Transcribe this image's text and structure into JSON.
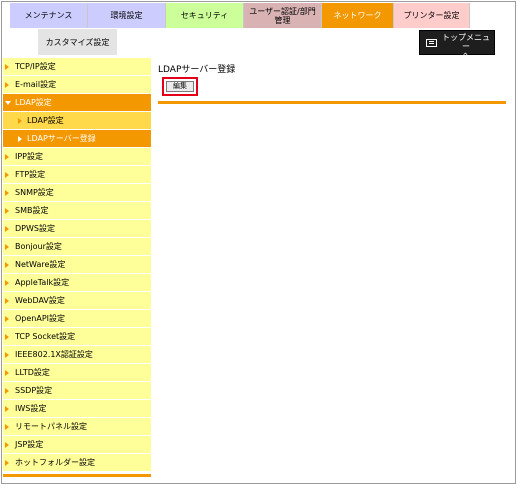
{
  "tabs": [
    {
      "label": "メンテナンス",
      "bg": "#ccccff",
      "fg": "#000000"
    },
    {
      "label": "環境設定",
      "bg": "#ccccff",
      "fg": "#000000"
    },
    {
      "label": "セキュリティ",
      "bg": "#ccff99",
      "fg": "#000000"
    },
    {
      "label": "ユーザー認証/部門\n管理",
      "bg": "#d9b3b3",
      "fg": "#000000"
    },
    {
      "label": "ネットワーク",
      "bg": "#f39800",
      "fg": "#ffffff"
    },
    {
      "label": "プリンター設定",
      "bg": "#ffcccc",
      "fg": "#000000"
    }
  ],
  "subtab": {
    "label": "カスタマイズ設定"
  },
  "topmenu": {
    "label": "トップメニュー\nへ",
    "icon": "top-menu-icon"
  },
  "sidebar": {
    "items": [
      {
        "label": "TCP/IP設定",
        "state": "normal"
      },
      {
        "label": "E-mail設定",
        "state": "normal"
      },
      {
        "label": "LDAP設定",
        "state": "open"
      },
      {
        "label": "LDAP設定",
        "state": "sub1"
      },
      {
        "label": "LDAPサーバー登録",
        "state": "sub2"
      },
      {
        "label": "IPP設定",
        "state": "normal"
      },
      {
        "label": "FTP設定",
        "state": "normal"
      },
      {
        "label": "SNMP設定",
        "state": "normal"
      },
      {
        "label": "SMB設定",
        "state": "normal"
      },
      {
        "label": "DPWS設定",
        "state": "normal"
      },
      {
        "label": "Bonjour設定",
        "state": "normal"
      },
      {
        "label": "NetWare設定",
        "state": "normal"
      },
      {
        "label": "AppleTalk設定",
        "state": "normal"
      },
      {
        "label": "WebDAV設定",
        "state": "normal"
      },
      {
        "label": "OpenAPI設定",
        "state": "normal"
      },
      {
        "label": "TCP Socket設定",
        "state": "normal"
      },
      {
        "label": "IEEE802.1X認証設定",
        "state": "normal"
      },
      {
        "label": "LLTD設定",
        "state": "normal"
      },
      {
        "label": "SSDP設定",
        "state": "normal"
      },
      {
        "label": "IWS設定",
        "state": "normal"
      },
      {
        "label": "リモートパネル設定",
        "state": "normal"
      },
      {
        "label": "JSP設定",
        "state": "normal"
      },
      {
        "label": "ホットフォルダー設定",
        "state": "normal"
      }
    ]
  },
  "main": {
    "title": "LDAPサーバー登録",
    "edit_label": "編集"
  },
  "colors": {
    "accent": "#f39800",
    "highlight": "#e5001a",
    "sidebar_bg": "#ffff9a"
  }
}
